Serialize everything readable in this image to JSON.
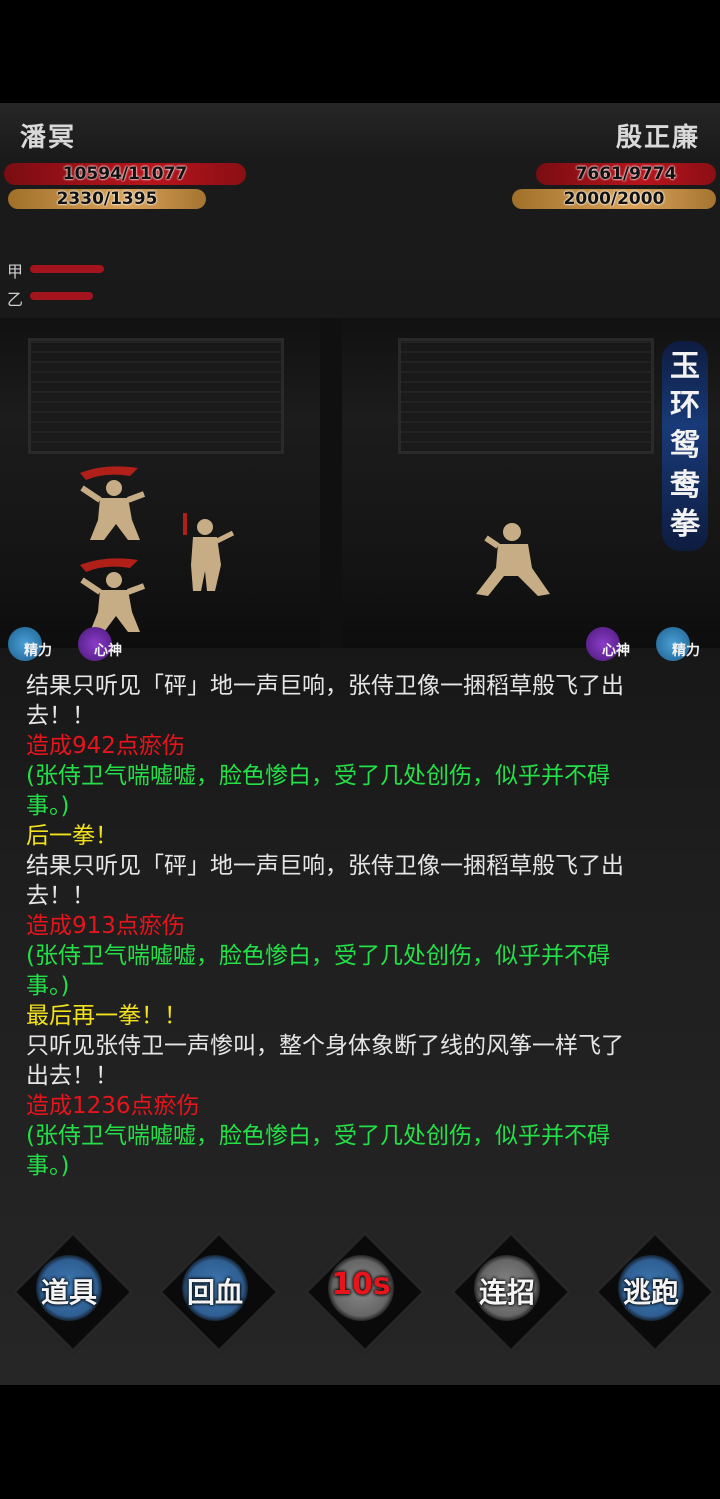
{
  "player": {
    "name": "潘冥",
    "hp": "10594/11077",
    "mp": "2330/1395"
  },
  "enemy": {
    "name": "殷正廉",
    "hp": "7661/9774",
    "mp": "2000/2000"
  },
  "minions": [
    {
      "label": "甲",
      "hp_fraction": 1.0
    },
    {
      "label": "乙",
      "hp_fraction": 0.85
    }
  ],
  "skill_name": [
    "玉",
    "环",
    "鸳",
    "鸯",
    "拳"
  ],
  "orbs": {
    "left": [
      "精力",
      "心神"
    ],
    "right": [
      "心神",
      "精力"
    ]
  },
  "log": [
    {
      "color": "w",
      "text": "结果只听见「砰」地一声巨响，张侍卫像一捆稻草般飞了出"
    },
    {
      "color": "w",
      "text": "去！！"
    },
    {
      "color": "r",
      "text": "造成942点瘀伤"
    },
    {
      "color": "g",
      "text": "(张侍卫气喘嘘嘘，脸色惨白，受了几处创伤，似乎并不碍"
    },
    {
      "color": "g",
      "text": "事。)"
    },
    {
      "color": "y",
      "text": "后一拳！"
    },
    {
      "color": "w",
      "text": "结果只听见「砰」地一声巨响，张侍卫像一捆稻草般飞了出"
    },
    {
      "color": "w",
      "text": "去！！"
    },
    {
      "color": "r",
      "text": "造成913点瘀伤"
    },
    {
      "color": "g",
      "text": "(张侍卫气喘嘘嘘，脸色惨白，受了几处创伤，似乎并不碍"
    },
    {
      "color": "g",
      "text": "事。)"
    },
    {
      "color": "y",
      "text": "最后再一拳！！"
    },
    {
      "color": "w",
      "text": "只听见张侍卫一声惨叫，整个身体象断了线的风筝一样飞了"
    },
    {
      "color": "w",
      "text": "出去！！"
    },
    {
      "color": "r",
      "text": "造成1236点瘀伤"
    },
    {
      "color": "g",
      "text": "(张侍卫气喘嘘嘘，脸色惨白，受了几处创伤，似乎并不碍"
    },
    {
      "color": "g",
      "text": "事。)"
    }
  ],
  "buttons": {
    "items": "道具",
    "heal": "回血",
    "cooldown": "10s",
    "combo": "连招",
    "flee": "逃跑"
  },
  "colors": {
    "hp": "#b8141c",
    "mp": "#d9a25a",
    "damage": "#e8141c",
    "status": "#24e048",
    "action": "#f2e21c"
  }
}
